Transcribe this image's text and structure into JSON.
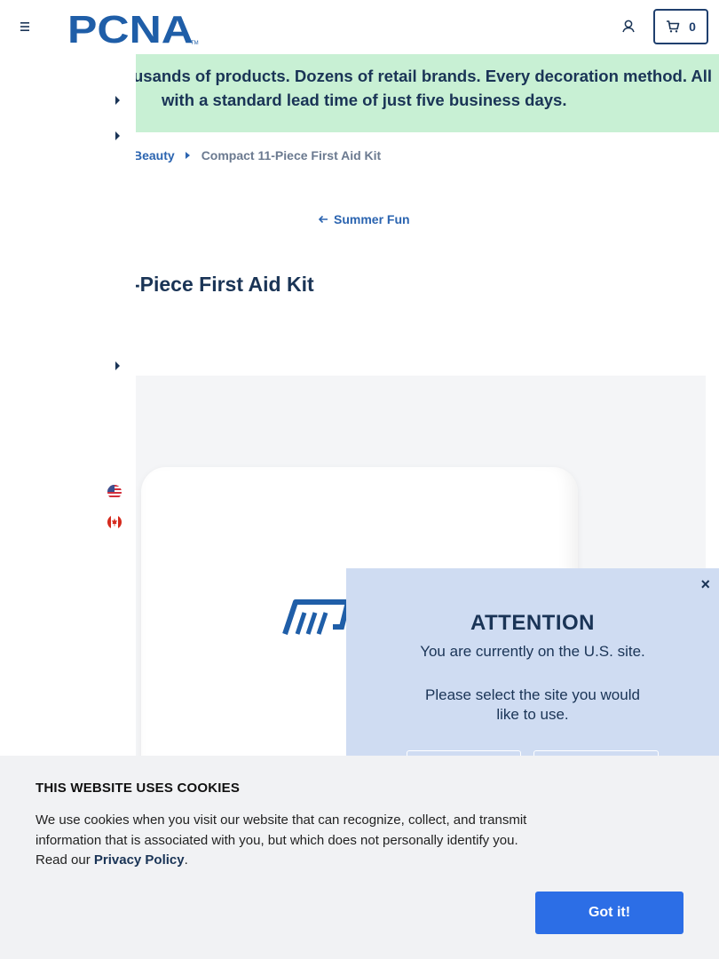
{
  "header": {
    "logo_text": "PCNA",
    "logo_tm": "TM",
    "cart_count": "0",
    "brand_color": "#1f5ea8"
  },
  "promo": {
    "line1": "usands of products. Dozens of retail brands. Every decoration method. All",
    "line2": "with a standard lead time of just five business days."
  },
  "breadcrumb": {
    "parent": "Beauty",
    "current": "Compact 11-Piece First Aid Kit"
  },
  "back_link": {
    "label": "Summer Fun"
  },
  "product": {
    "title": "-Piece First Aid Kit"
  },
  "region_popup": {
    "close_label": "×",
    "title": "ATTENTION",
    "current_site": "You are currently on the U.S. site.",
    "prompt": "Please select the site you would like to use."
  },
  "cookie_bar": {
    "title": "THIS WEBSITE USES COOKIES",
    "text": "We use cookies when you visit our website that can recognize, collect, and transmit information that is associated with you, but which does not personally identify you. Read our ",
    "privacy_link": "Privacy Policy",
    "text_end": ".",
    "accept_label": "Got it!"
  }
}
